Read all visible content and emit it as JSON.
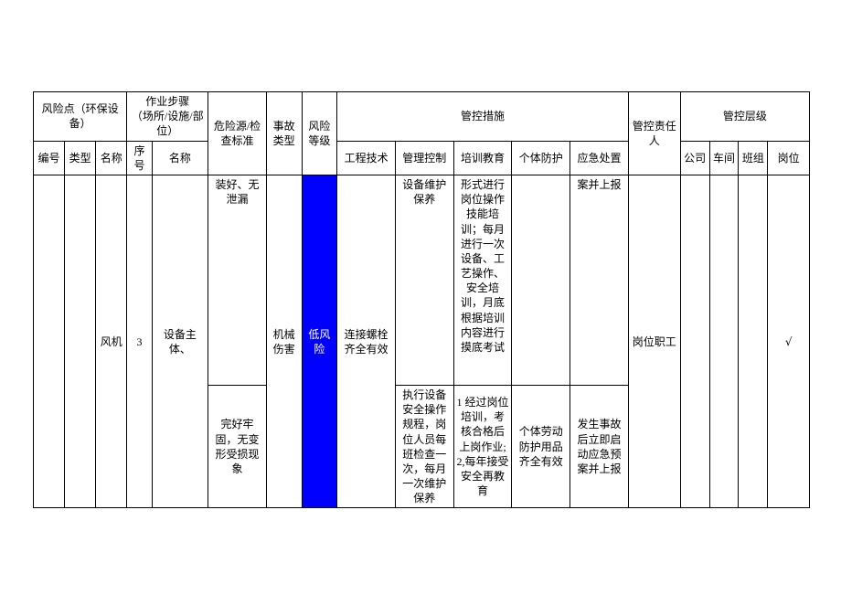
{
  "headers": {
    "risk_point": "风险点（环保设备）",
    "work_step": "作业步骤\n（场所/设施/部位）",
    "hazard": "危险源/检查标准",
    "accident_type": "事故类型",
    "risk_level": "风险等级",
    "control_measures": "管控措施",
    "control_person": "管控责任人",
    "control_level": "管控层级",
    "sub": {
      "id": "编号",
      "type": "类型",
      "name": "名称",
      "seq": "序号",
      "step_name": "名称",
      "eng_tech": "工程技术",
      "mgmt_ctrl": "管理控制",
      "training": "培训教育",
      "ppe": "个体防护",
      "emergency": "应急处置",
      "company": "公司",
      "workshop": "车间",
      "team": "班组",
      "post": "岗位"
    }
  },
  "rows": [
    {
      "hazard": "装好、无泄漏",
      "mgmt_ctrl": "设备维护保养",
      "training": "形式进行岗位操作技能培训；每月进行一次设备、工艺操作、安全培训，月底根据培训内容进行摸底考试",
      "emergency": "案并上报"
    },
    {
      "name": "风机",
      "seq": "3",
      "step_name": "设备主体、",
      "hazard": "完好牢固，无变形受损现象",
      "accident_type": "机械伤害",
      "risk_level": "低风险",
      "eng_tech": "连接螺栓齐全有效",
      "mgmt_ctrl": "执行设备安全操作规程，岗位人员每班检查一次，每月一次维护保养",
      "training": "1 经过岗位培训，考核合格后上岗作业; 2,每年接受安全再教育",
      "ppe": "个体劳动防护用品齐全有效",
      "emergency": "发生事故后立即启动应急预案并上报",
      "person": "岗位职工",
      "post_check": "√"
    }
  ]
}
